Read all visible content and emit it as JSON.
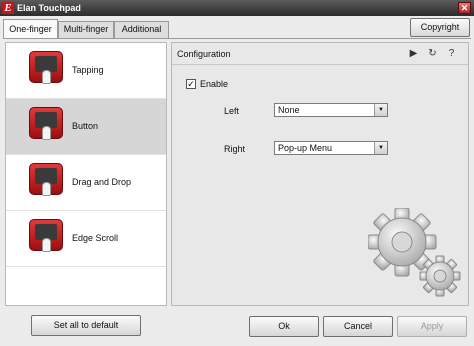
{
  "window": {
    "title": "Elan Touchpad",
    "logo_letter": "E"
  },
  "tabs": [
    {
      "label": "One-finger",
      "active": true
    },
    {
      "label": "Multi-finger",
      "active": false
    },
    {
      "label": "Additional",
      "active": false
    }
  ],
  "copyright_label": "Copyright",
  "features": [
    {
      "label": "Tapping",
      "icon": "tapping-icon",
      "selected": false
    },
    {
      "label": "Button",
      "icon": "button-icon",
      "selected": true
    },
    {
      "label": "Drag and Drop",
      "icon": "drag-and-drop-icon",
      "selected": false
    },
    {
      "label": "Edge Scroll",
      "icon": "edge-scroll-icon",
      "selected": false
    }
  ],
  "config": {
    "title": "Configuration",
    "enable": {
      "label": "Enable",
      "checked": true
    },
    "left": {
      "label": "Left",
      "value": "None"
    },
    "right": {
      "label": "Right",
      "value": "Pop-up Menu"
    }
  },
  "buttons": {
    "set_default": "Set all to default",
    "ok": "Ok",
    "cancel": "Cancel",
    "apply": "Apply"
  },
  "colors": {
    "accent_red": "#c4161c",
    "titlebar": "#2c2c2c"
  }
}
